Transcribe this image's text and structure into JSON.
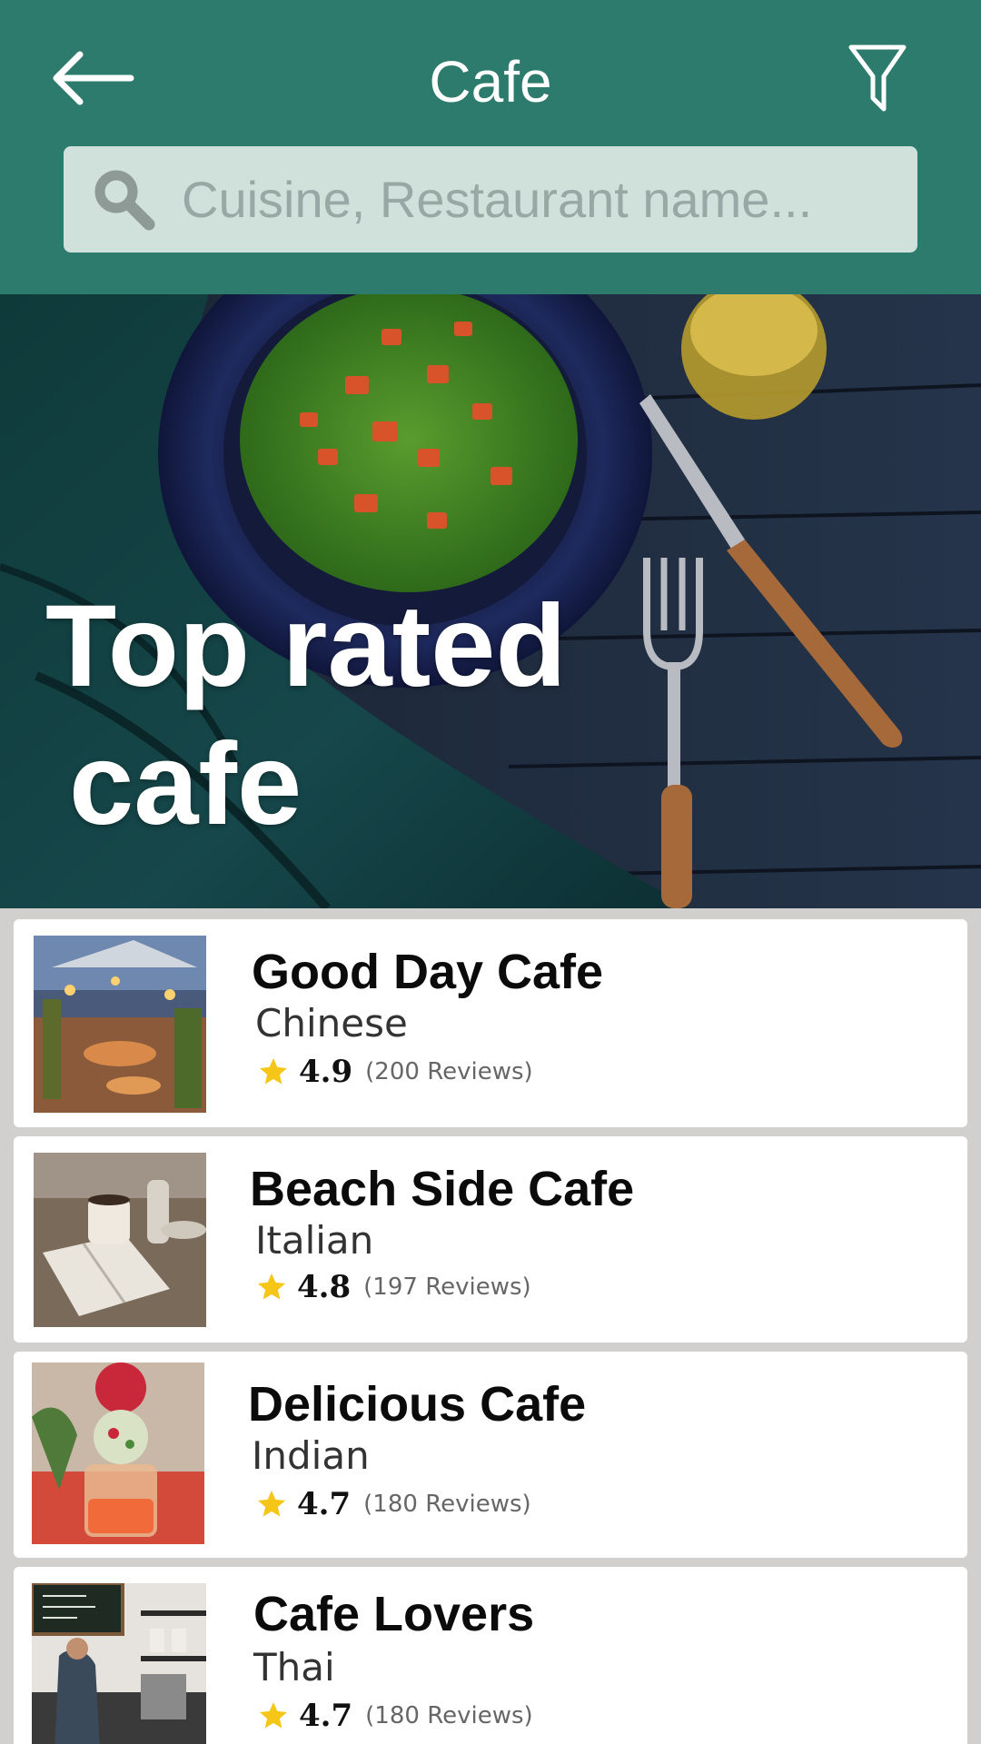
{
  "header": {
    "title": "Cafe",
    "back_icon": "arrow-left-icon",
    "filter_icon": "filter-funnel-icon",
    "bg_color": "#2c7b6c"
  },
  "search": {
    "placeholder": "Cuisine, Restaurant name...",
    "value": "",
    "icon": "search-icon"
  },
  "hero": {
    "title_line1": "Top rated",
    "title_line2": "cafe",
    "image": "salad-plate-on-dark-table-photo"
  },
  "cafes": [
    {
      "name": "Good Day Cafe",
      "cuisine": "Chinese",
      "rating": "4.9",
      "reviews": "(200 Reviews)",
      "image": "outdoor-patio-photo"
    },
    {
      "name": "Beach Side Cafe",
      "cuisine": "Italian",
      "rating": "4.8",
      "reviews": "(197 Reviews)",
      "image": "notebook-coffee-table-photo"
    },
    {
      "name": "Delicious Cafe",
      "cuisine": "Indian",
      "rating": "4.7",
      "reviews": "(180 Reviews)",
      "image": "ice-cream-dessert-photo"
    },
    {
      "name": "Cafe Lovers",
      "cuisine": "Thai",
      "rating": "4.7",
      "reviews": "(180 Reviews)",
      "image": "barista-counter-photo"
    }
  ],
  "colors": {
    "accent": "#2c7b6c",
    "star": "#f5c518",
    "list_bg": "#d2cfcf"
  }
}
